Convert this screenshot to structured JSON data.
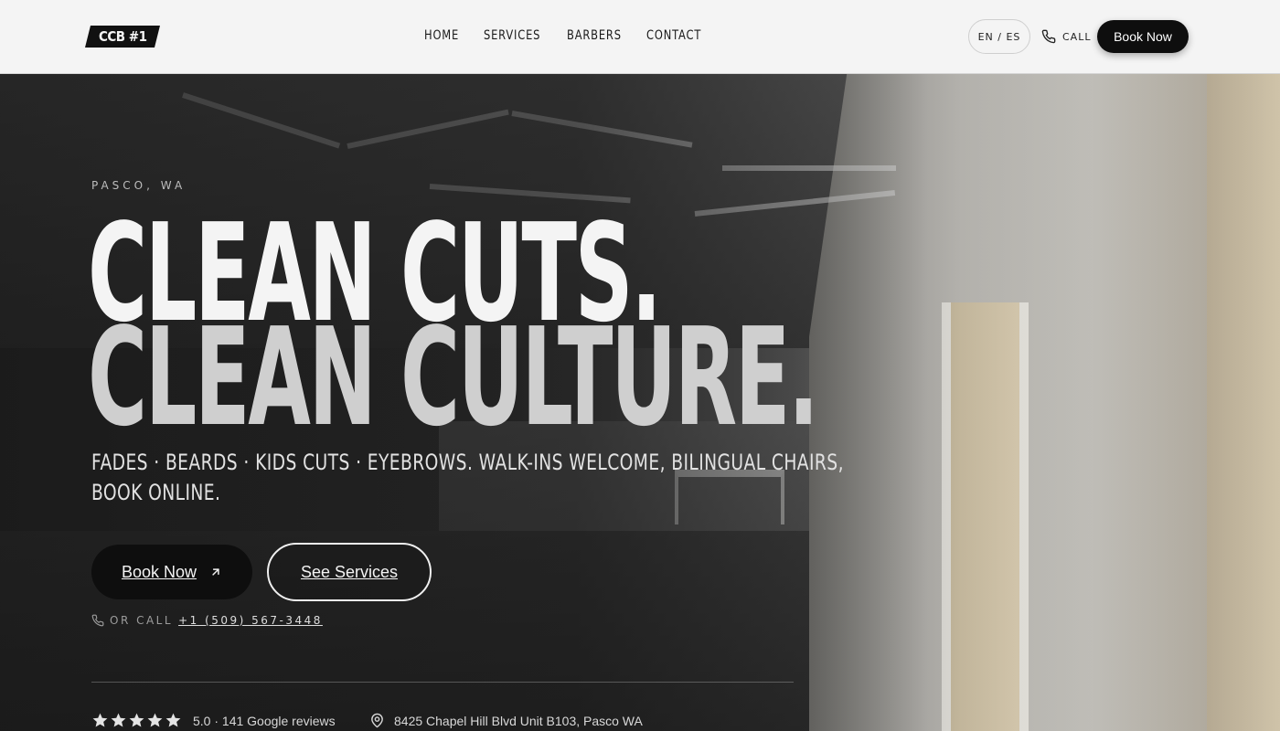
{
  "header": {
    "logo_text": "CCB #1",
    "nav": [
      {
        "label": "HOME"
      },
      {
        "label": "SERVICES"
      },
      {
        "label": "BARBERS"
      },
      {
        "label": "CONTACT"
      }
    ],
    "lang_toggle": "EN / ES",
    "call_label": "CALL",
    "book_label": "Book Now"
  },
  "hero": {
    "eyebrow": "PASCO, WA",
    "headline_line1": "CLEAN CUTS.",
    "headline_line2": "CLEAN CULTURE.",
    "subtitle": "FADES · BEARDS · KIDS CUTS · EYEBROWS. WALK-INS WELCOME, BILINGUAL CHAIRS, BOOK ONLINE.",
    "primary_button": "Book Now",
    "secondary_button": "See Services",
    "or_call_label": "OR CALL",
    "phone": "+1 (509) 567-3448",
    "rating_text": "5.0 · 141 Google reviews",
    "star_count": 5,
    "address": "8425 Chapel Hill Blvd Unit B103, Pasco WA"
  },
  "icons": {
    "phone": "phone-icon",
    "arrow": "arrow-up-right-icon",
    "star": "star-icon",
    "pin": "map-pin-icon"
  },
  "colors": {
    "header_bg": "#f4f4f4",
    "button_dark": "#0e0e0e",
    "headline_primary": "#f4f4f4",
    "headline_secondary": "#cfcfcf"
  }
}
